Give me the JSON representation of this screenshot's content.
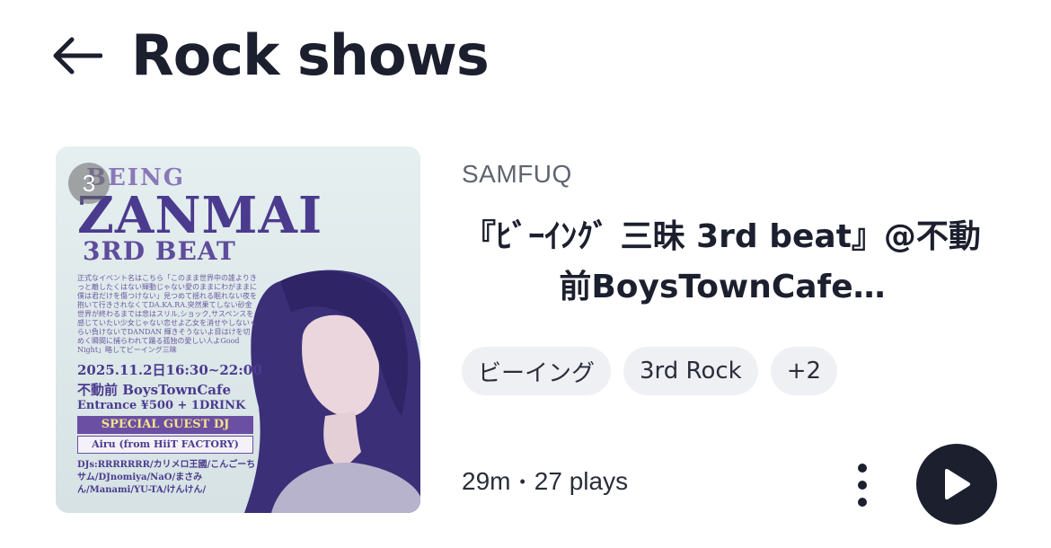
{
  "header": {
    "title": "Rock shows",
    "back_icon": "arrow-left-icon"
  },
  "item": {
    "track_number": "3",
    "artist": "SAMFUQ",
    "title": "『ﾋﾞｰｲﾝｸﾞ 三昧 3rd beat』@不動前BoysTownCafe…",
    "tags": [
      "ビーイング",
      "3rd Rock",
      "+2"
    ],
    "duration": "29m",
    "separator": "•",
    "plays": "27 plays",
    "artwork": {
      "being": "BEING",
      "zanmai": "ZANMAI",
      "beat": "3RD BEAT",
      "desc": "正式なイベント名はこちら「このまま世界中の誰よりきっと離したくはない輝動じゃない愛のままにわがままに僕は君だけを傷つけない」見つめて揺れる眠れない夜を抱いて行きされなくてDA.KA.RA.突然果てしない砂金世界が終わるまでは悲はスリル,ショック,サスペンスを感じていたい少女じゃない恋せよ乙女を消せやしないくらい負けないでDANDAN 輝きそうないよ目はけを切めく瞬間に捕らわれて踊る孤独の愛しい人よGood Night」略してビーイング三昧",
      "date": "2025.11.2日16:30~22:00",
      "venue": "不動前 BoysTownCafe",
      "entrance": "Entrance ¥500 + 1DRINK",
      "guest_label": "SPECIAL GUEST DJ",
      "guest": "Airu (from HiiT FACTORY)",
      "djs": "DJs:RRRRRRR/カリメロ王國/こんごーちサム/DJnomiya/NaO/まさみん/Manami/YU-TA/けんけん/"
    }
  },
  "colors": {
    "primary": "#1b1f2e",
    "chip_bg": "#eff0f4",
    "muted": "#5f6470",
    "artwork_bg": "#dfe9ea"
  },
  "icons": {
    "more": "more-vertical-icon",
    "play": "play-icon"
  }
}
